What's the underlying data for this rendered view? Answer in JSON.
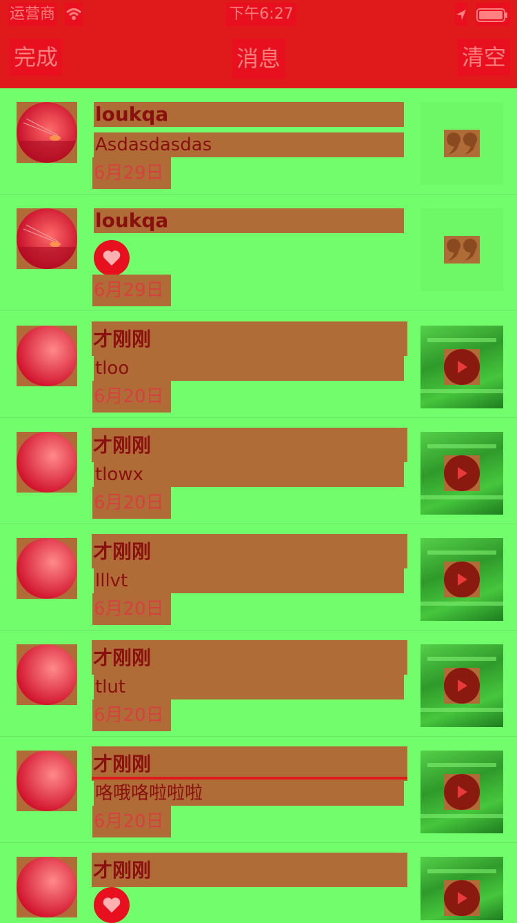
{
  "status_bar": {
    "carrier": "运营商",
    "time": "下午6:27"
  },
  "nav": {
    "left": "完成",
    "title": "消息",
    "right": "清空"
  },
  "rows": [
    {
      "name": "loukqa",
      "message": "Asdasdasdas",
      "date": "6月29日",
      "kind": "comment",
      "preview": "quote"
    },
    {
      "name": "loukqa",
      "message": "",
      "date": "6月29日",
      "kind": "like",
      "preview": "quote"
    },
    {
      "name": "才刚刚",
      "message": "tloo",
      "date": "6月20日",
      "kind": "comment",
      "preview": "video"
    },
    {
      "name": "才刚刚",
      "message": "tlowx",
      "date": "6月20日",
      "kind": "comment",
      "preview": "video"
    },
    {
      "name": "才刚刚",
      "message": "lllvt",
      "date": "6月20日",
      "kind": "comment",
      "preview": "video"
    },
    {
      "name": "才刚刚",
      "message": "tlut",
      "date": "6月20日",
      "kind": "comment",
      "preview": "video"
    },
    {
      "name": "才刚刚",
      "message": "咯哦咯啦啦啦",
      "date": "6月20日",
      "kind": "comment",
      "preview": "video"
    },
    {
      "name": "才刚刚",
      "message": "",
      "date": "",
      "kind": "like",
      "preview": "video"
    }
  ],
  "colors": {
    "bar": "#e01a1a",
    "background": "#72fe6c",
    "highlight": "#b06c36"
  }
}
